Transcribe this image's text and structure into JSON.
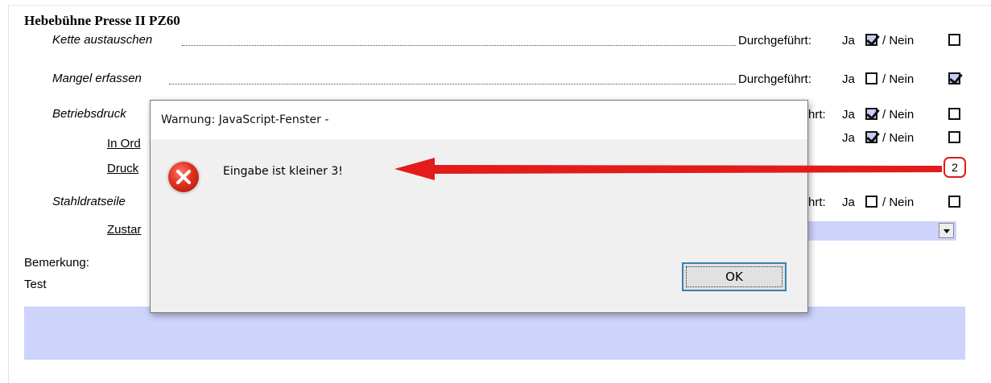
{
  "form": {
    "title": "Hebebühne Presse II PZ60",
    "tasks": [
      {
        "label": "Kette austauschen",
        "status_label": "Durchgeführt:",
        "ja": "Ja",
        "nein": "/ Nein"
      },
      {
        "label": "Mangel erfassen",
        "status_label": "Durchgeführt:",
        "ja": "Ja",
        "nein": "/ Nein"
      },
      {
        "label": "Betriebsdruck",
        "status_label": "hrt:",
        "ja": "Ja",
        "nein": "/ Nein"
      },
      {
        "label": "Stahldratseile",
        "status_label": "hrt:",
        "ja": "Ja",
        "nein": "/ Nein"
      }
    ],
    "sub_in_ordnung": {
      "label": "In Ord",
      "ja": "Ja",
      "nein": "/ Nein"
    },
    "sub_druck": {
      "label": "Druck",
      "value": "2"
    },
    "sub_zustand": {
      "label": "Zustar"
    },
    "checkboxes": {
      "kette_ja": true,
      "kette_nein": false,
      "mangel_ja": false,
      "mangel_nein": true,
      "betrieb_ja": true,
      "betrieb_nein": false,
      "inord_ja": true,
      "inord_nein": false,
      "stahl_ja": false,
      "stahl_nein": false
    },
    "remark_label": "Bemerkung:",
    "remark_value": "Test"
  },
  "dialog": {
    "title": "Warnung: JavaScript-Fenster -",
    "message": "Eingabe ist kleiner 3!",
    "ok_label": "OK",
    "icon": "error-icon"
  },
  "annotation": {
    "arrow_color": "#e31b1b",
    "highlight_color": "#e01b1b"
  },
  "colors": {
    "field_blue": "#cdd3fb",
    "dialog_bg": "#f0f0f0",
    "ok_border": "#3c7fb1"
  }
}
